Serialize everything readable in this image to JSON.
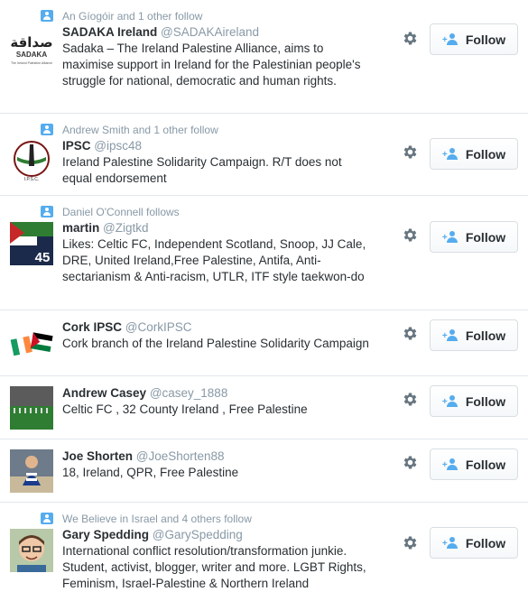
{
  "follow_label": "Follow",
  "accounts": [
    {
      "context": "An Gíogóir and 1 other follow",
      "name": "SADAKA Ireland",
      "handle": "@SADAKAireland",
      "bio": "Sadaka – The Ireland Palestine Alliance, aims to maximise support in Ireland for the Palestinian people's struggle for national, democratic and human rights.",
      "avatar_text": "صداقة",
      "avatar_sub": "SADAKA",
      "avatar_small": "The Ireland Palestine Alliance"
    },
    {
      "context": "Andrew Smith and 1 other follow",
      "name": "IPSC",
      "handle": "@ipsc48",
      "bio": "Ireland Palestine Solidarity Campaign.  R/T does not equal endorsement",
      "avatar_text": "I.P.S.C."
    },
    {
      "context": "Daniel O'Connell follows",
      "name": "martin",
      "handle": "@Zigtkd",
      "bio": "Likes: Celtic FC, Independent Scotland, Snoop, JJ Cale, DRE, United Ireland,Free Palestine, Antifa, Anti-sectarianism & Anti-racism, UTLR, ITF style taekwon-do",
      "avatar_text": "45"
    },
    {
      "context": "",
      "name": "Cork IPSC",
      "handle": "@CorkIPSC",
      "bio": "Cork branch of the Ireland Palestine Solidarity Campaign"
    },
    {
      "context": "",
      "name": "Andrew Casey",
      "handle": "@casey_1888",
      "bio": "Celtic FC , 32 County Ireland , Free Palestine"
    },
    {
      "context": "",
      "name": "Joe Shorten",
      "handle": "@JoeShorten88",
      "bio": "18, Ireland, QPR, Free Palestine"
    },
    {
      "context": "We Believe in Israel and 4 others follow",
      "name": "Gary Spedding",
      "handle": "@GarySpedding",
      "bio": "International conflict resolution/transformation junkie. Student, activist, blogger, writer and more. LGBT Rights, Feminism, Israel-Palestine & Northern Ireland"
    }
  ]
}
